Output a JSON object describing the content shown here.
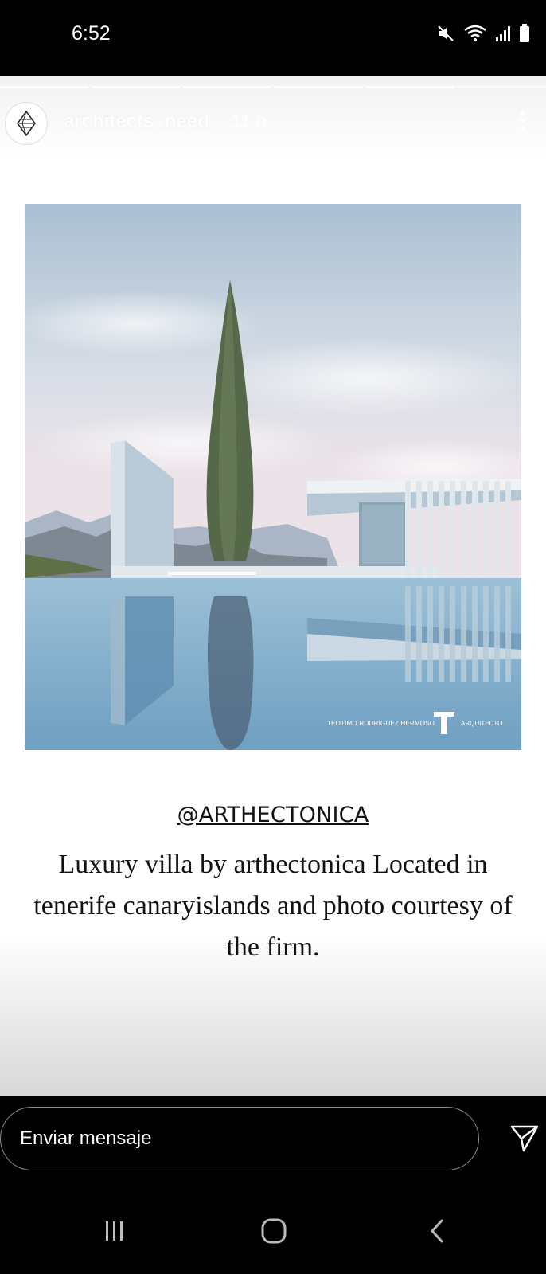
{
  "status_bar": {
    "time": "6:52",
    "icons": [
      "mute-icon",
      "wifi-icon",
      "signal-icon",
      "battery-icon"
    ]
  },
  "story": {
    "progress_segments": 6,
    "active_segment": 1,
    "username": "architects_need",
    "timestamp": "11 h",
    "image_watermark_left": "TEOTIMO RODRÍGUEZ HERMOSO",
    "image_watermark_right": "ARQUITECTO",
    "mention": "@ARTHECTONICA",
    "caption": "Luxury villa by arthectonica Located in tenerife canaryislands and photo courtesy of the firm."
  },
  "reply": {
    "placeholder": "Enviar mensaje"
  },
  "nav": {
    "icons": [
      "recent-apps-icon",
      "home-icon",
      "back-icon"
    ]
  },
  "colors": {
    "background": "#000000",
    "story_bg": "#ffffff",
    "text": "#111111",
    "sky": "#b9c8d6",
    "water": "#8fb3cc"
  }
}
